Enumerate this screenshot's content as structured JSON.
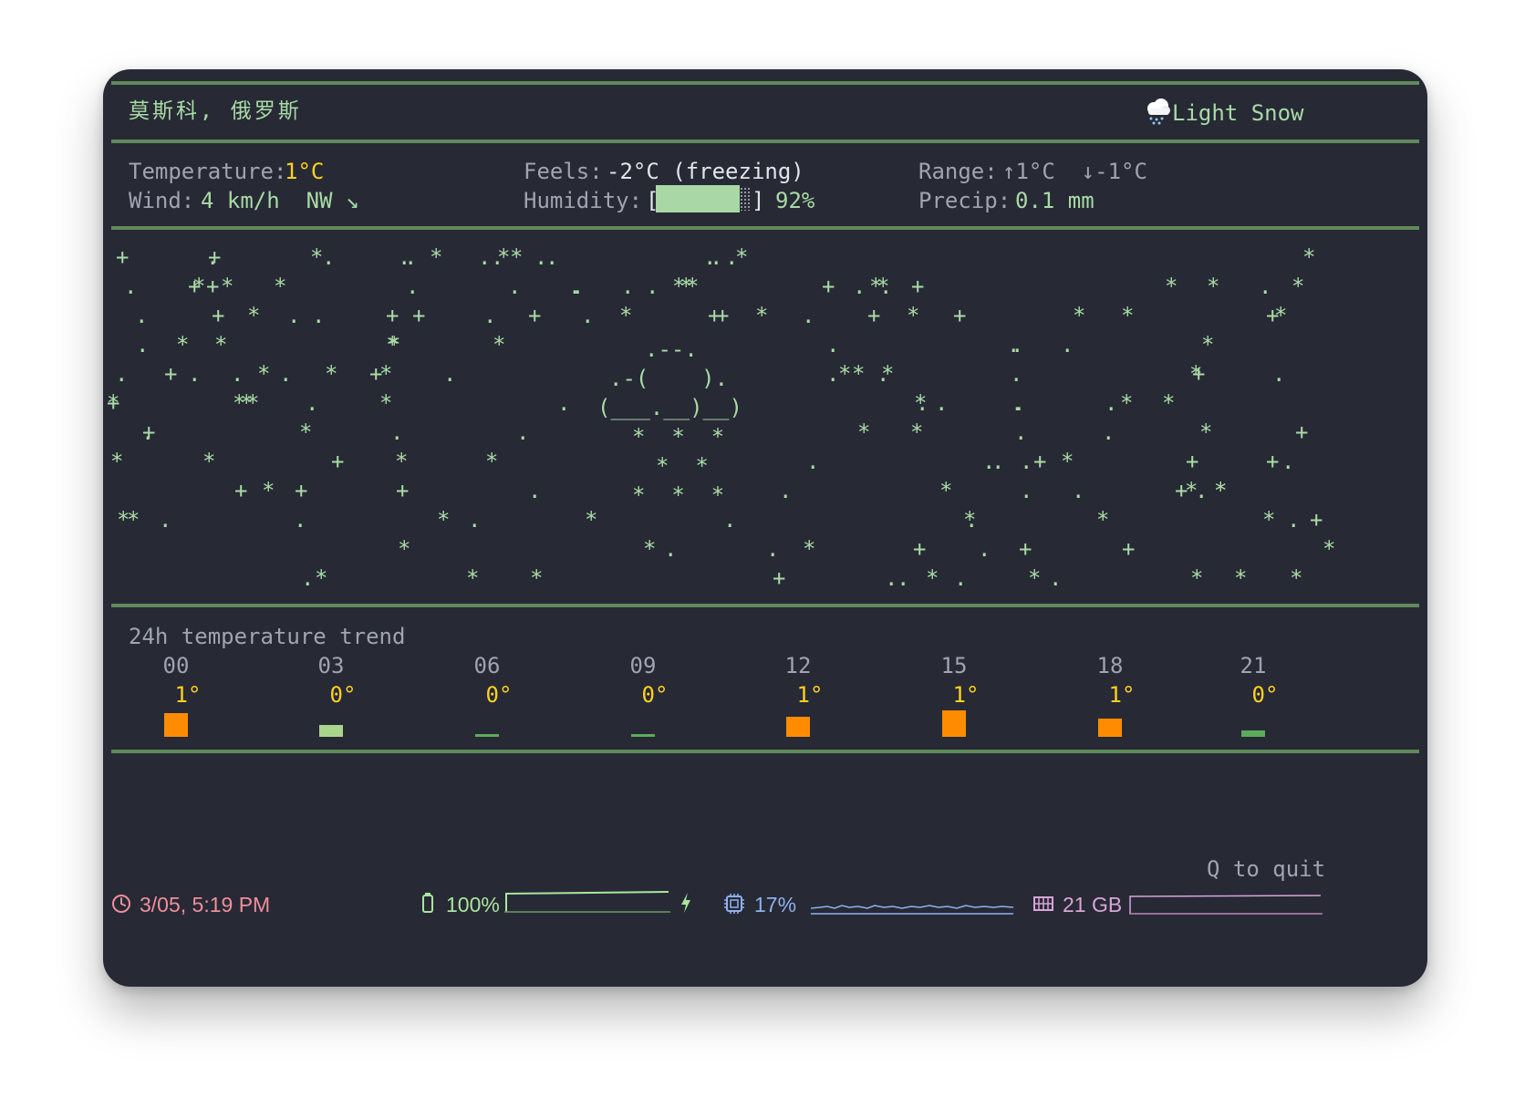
{
  "header": {
    "location": "莫斯科, 俄罗斯",
    "condition_icon": "snow-cloud-icon",
    "condition": "Light Snow"
  },
  "stats": {
    "temperature_label": "Temperature:",
    "temperature_value": "1°C",
    "wind_label": "Wind:",
    "wind_value": "4 km/h  NW ↘",
    "feels_label": "Feels:",
    "feels_value": "-2°C (freezing)",
    "humidity_label": "Humidity:",
    "humidity_open": "[",
    "humidity_close": "]",
    "humidity_value": "92%",
    "humidity_fraction": 0.92,
    "range_label": "Range:",
    "range_value": "↑1°C  ↓-1°C",
    "precip_label": "Precip:",
    "precip_value": "0.1 mm"
  },
  "art": {
    "cloud": [
      ".--.",
      ".-(    ).",
      "(___.__)__)"
    ],
    "flakes": [
      "*  *  *",
      "*  *",
      "*  *  *"
    ]
  },
  "trend": {
    "title": "24h temperature trend",
    "hours": [
      {
        "hour": "00",
        "temp": "1°",
        "level": 1,
        "color": "#ff8c00"
      },
      {
        "hour": "03",
        "temp": "0°",
        "level": 0.5,
        "color": "#a9d68c"
      },
      {
        "hour": "06",
        "temp": "0°",
        "level": 0.1,
        "color": "#5cab5c"
      },
      {
        "hour": "09",
        "temp": "0°",
        "level": 0.1,
        "color": "#5cab5c"
      },
      {
        "hour": "12",
        "temp": "1°",
        "level": 0.85,
        "color": "#ff8c00"
      },
      {
        "hour": "15",
        "temp": "1°",
        "level": 1.1,
        "color": "#ff8c00"
      },
      {
        "hour": "18",
        "temp": "1°",
        "level": 0.75,
        "color": "#ff8c00"
      },
      {
        "hour": "21",
        "temp": "0°",
        "level": 0.25,
        "color": "#5cab5c"
      }
    ]
  },
  "footer": {
    "quit_hint": "Q to quit",
    "clock_icon": "clock-icon",
    "datetime": "3/05, 5:19 PM",
    "battery_icon": "battery-icon",
    "battery": "100%",
    "charging_icon": "lightning-icon",
    "cpu_icon": "cpu-icon",
    "cpu": "17%",
    "memory_icon": "memory-icon",
    "memory": "21 GB",
    "colors": {
      "clock": "#ef8f9a",
      "battery": "#a9e69d",
      "cpu": "#8eb1ee",
      "memory": "#d9a4d8"
    }
  }
}
